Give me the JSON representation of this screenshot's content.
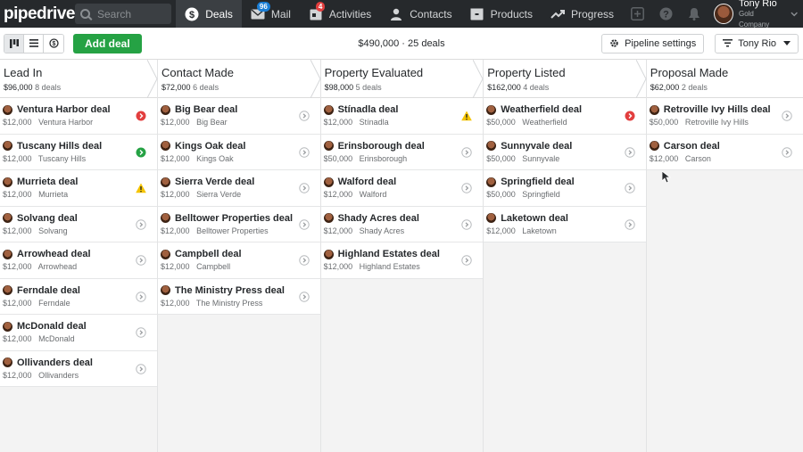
{
  "nav": {
    "logo": "pipedrive",
    "search_placeholder": "Search",
    "items": [
      {
        "label": "Deals",
        "icon": "dollar-icon",
        "active": true
      },
      {
        "label": "Mail",
        "icon": "mail-icon",
        "badge": "96"
      },
      {
        "label": "Activities",
        "icon": "calendar-icon",
        "badge": "4"
      },
      {
        "label": "Contacts",
        "icon": "person-icon"
      },
      {
        "label": "Products",
        "icon": "box-icon"
      },
      {
        "label": "Progress",
        "icon": "chart-icon"
      }
    ],
    "user": {
      "name": "Tony Rio",
      "company": "Gold Company"
    }
  },
  "toolbar": {
    "add_deal": "Add deal",
    "summary": "$490,000 · 25 deals",
    "pipeline_settings": "Pipeline settings",
    "filter": "Tony Rio"
  },
  "colors": {
    "green": "#25a244",
    "red": "#e23e3e",
    "yellow": "#f5c400",
    "nav_bg": "#26292c"
  },
  "stages": [
    {
      "title": "Lead In",
      "amount": "$96,000",
      "count": "8 deals",
      "deals": [
        {
          "title": "Ventura Harbor deal",
          "value": "$12,000",
          "org": "Ventura Harbor",
          "status": "red"
        },
        {
          "title": "Tuscany Hills deal",
          "value": "$12,000",
          "org": "Tuscany Hills",
          "status": "green"
        },
        {
          "title": "Murrieta deal",
          "value": "$12,000",
          "org": "Murrieta",
          "status": "warning"
        },
        {
          "title": "Solvang deal",
          "value": "$12,000",
          "org": "Solvang",
          "status": "grey"
        },
        {
          "title": "Arrowhead deal",
          "value": "$12,000",
          "org": "Arrowhead",
          "status": "grey"
        },
        {
          "title": "Ferndale deal",
          "value": "$12,000",
          "org": "Ferndale",
          "status": "grey"
        },
        {
          "title": "McDonald deal",
          "value": "$12,000",
          "org": "McDonald",
          "status": "grey"
        },
        {
          "title": "Ollivanders deal",
          "value": "$12,000",
          "org": "Ollivanders",
          "status": "grey"
        }
      ]
    },
    {
      "title": "Contact Made",
      "amount": "$72,000",
      "count": "6 deals",
      "deals": [
        {
          "title": "Big Bear deal",
          "value": "$12,000",
          "org": "Big Bear",
          "status": "grey"
        },
        {
          "title": "Kings Oak deal",
          "value": "$12,000",
          "org": "Kings Oak",
          "status": "grey"
        },
        {
          "title": "Sierra Verde deal",
          "value": "$12,000",
          "org": "Sierra Verde",
          "status": "grey"
        },
        {
          "title": "Belltower Properties deal",
          "value": "$12,000",
          "org": "Belltower Properties",
          "status": "grey"
        },
        {
          "title": "Campbell deal",
          "value": "$12,000",
          "org": "Campbell",
          "status": "grey"
        },
        {
          "title": "The Ministry Press deal",
          "value": "$12,000",
          "org": "The Ministry Press",
          "status": "grey"
        }
      ]
    },
    {
      "title": "Property Evaluated",
      "amount": "$98,000",
      "count": "5 deals",
      "deals": [
        {
          "title": "Stínadla deal",
          "value": "$12,000",
          "org": "Stínadla",
          "status": "warning"
        },
        {
          "title": "Erinsborough deal",
          "value": "$50,000",
          "org": "Erinsborough",
          "status": "grey"
        },
        {
          "title": "Walford deal",
          "value": "$12,000",
          "org": "Walford",
          "status": "grey"
        },
        {
          "title": "Shady Acres deal",
          "value": "$12,000",
          "org": "Shady Acres",
          "status": "grey"
        },
        {
          "title": "Highland Estates deal",
          "value": "$12,000",
          "org": "Highland Estates",
          "status": "grey"
        }
      ]
    },
    {
      "title": "Property Listed",
      "amount": "$162,000",
      "count": "4 deals",
      "deals": [
        {
          "title": "Weatherfield deal",
          "value": "$50,000",
          "org": "Weatherfield",
          "status": "red"
        },
        {
          "title": "Sunnyvale deal",
          "value": "$50,000",
          "org": "Sunnyvale",
          "status": "grey"
        },
        {
          "title": "Springfield deal",
          "value": "$50,000",
          "org": "Springfield",
          "status": "grey"
        },
        {
          "title": "Laketown deal",
          "value": "$12,000",
          "org": "Laketown",
          "status": "grey"
        }
      ]
    },
    {
      "title": "Proposal Made",
      "amount": "$62,000",
      "count": "2 deals",
      "deals": [
        {
          "title": "Retroville Ivy Hills deal",
          "value": "$50,000",
          "org": "Retroville Ivy Hills",
          "status": "grey"
        },
        {
          "title": "Carson deal",
          "value": "$12,000",
          "org": "Carson",
          "status": "grey"
        }
      ]
    }
  ]
}
